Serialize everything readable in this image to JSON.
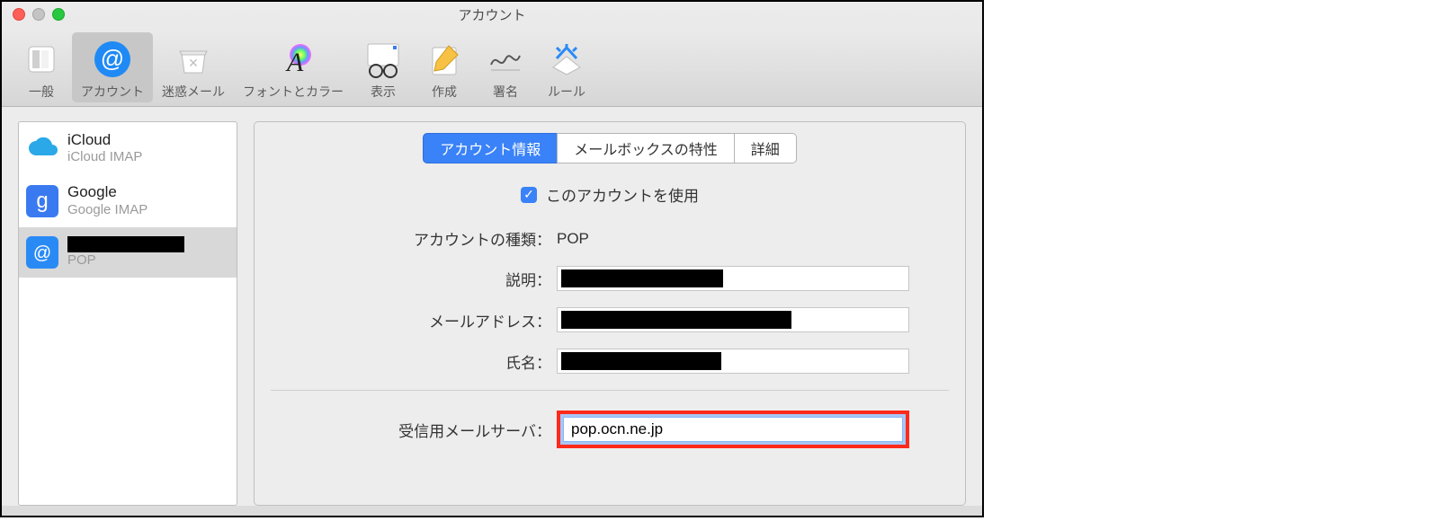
{
  "window": {
    "title": "アカウント"
  },
  "toolbar": {
    "general": "一般",
    "accounts": "アカウント",
    "junk": "迷惑メール",
    "fonts": "フォントとカラー",
    "viewing": "表示",
    "composing": "作成",
    "signatures": "署名",
    "rules": "ルール"
  },
  "sidebar": {
    "accounts": [
      {
        "name": "iCloud",
        "sub": "iCloud IMAP"
      },
      {
        "name": "Google",
        "sub": "Google IMAP"
      },
      {
        "name": "",
        "sub": "POP"
      }
    ]
  },
  "tabs": {
    "info": "アカウント情報",
    "mailbox": "メールボックスの特性",
    "advanced": "詳細"
  },
  "form": {
    "enable_label": "このアカウントを使用",
    "enable_checked": true,
    "type_label": "アカウントの種類：",
    "type_value": "POP",
    "description_label": "説明：",
    "email_label": "メールアドレス：",
    "fullname_label": "氏名：",
    "incoming_label": "受信用メールサーバ：",
    "incoming_value": "pop.ocn.ne.jp"
  }
}
